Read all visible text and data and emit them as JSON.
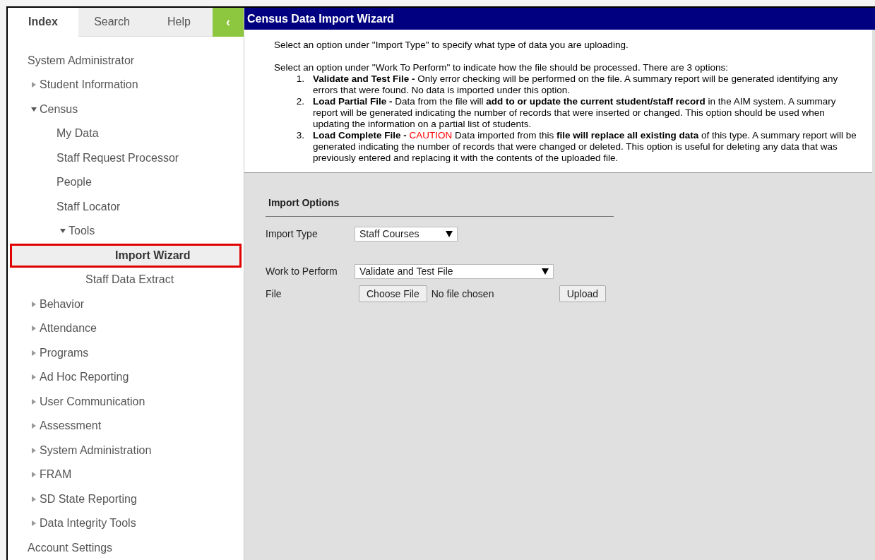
{
  "tabs": [
    {
      "label": "Index",
      "selected": true
    },
    {
      "label": "Search",
      "selected": false
    },
    {
      "label": "Help",
      "selected": false
    }
  ],
  "collapse_button": {
    "label": "‹"
  },
  "tree": [
    {
      "label": "System Administrator",
      "selected": false
    },
    {
      "label": "Student Information",
      "expanded": false,
      "selected": false
    },
    {
      "label": "Census",
      "expanded": true,
      "selected": false,
      "children": [
        {
          "label": "My Data",
          "selected": false
        },
        {
          "label": "Staff Request Processor",
          "selected": false
        },
        {
          "label": "People",
          "selected": false
        },
        {
          "label": "Staff Locator",
          "selected": false
        },
        {
          "label": "Tools",
          "expanded": true,
          "selected": false,
          "children": [
            {
              "label": "Import Wizard",
              "selected": true
            },
            {
              "label": "Staff Data Extract",
              "selected": false
            }
          ]
        }
      ]
    },
    {
      "label": "Behavior",
      "expanded": false,
      "selected": false
    },
    {
      "label": "Attendance",
      "expanded": false,
      "selected": false
    },
    {
      "label": "Programs",
      "expanded": false,
      "selected": false
    },
    {
      "label": "Ad Hoc Reporting",
      "expanded": false,
      "selected": false
    },
    {
      "label": "User Communication",
      "expanded": false,
      "selected": false
    },
    {
      "label": "Assessment",
      "expanded": false,
      "selected": false
    },
    {
      "label": "System Administration",
      "expanded": false,
      "selected": false
    },
    {
      "label": "FRAM",
      "expanded": false,
      "selected": false
    },
    {
      "label": "SD State Reporting",
      "expanded": false,
      "selected": false
    },
    {
      "label": "Data Integrity Tools",
      "expanded": false,
      "selected": false
    },
    {
      "label": "Account Settings",
      "selected": false
    }
  ],
  "page": {
    "title": "Census Data Import Wizard",
    "intro": "Select an option under \"Import Type\" to specify what type of data you are uploading.",
    "lead": "Select an option under \"Work To Perform\" to indicate how the file should be processed. There are 3 options:",
    "options": [
      {
        "number": "1.",
        "text": "**Validate and Test File -** Only error checking will be performed on the file. A summary report will be generated identifying any errors that were found. No data is imported under this option."
      },
      {
        "number": "2.",
        "text": "**Load Partial File -** Data from the file will **add to or update the current student/staff record** in the AIM system. A summary report will be generated indicating the number of records that were inserted or changed. This option should be used when updating the information on a partial list of students."
      },
      {
        "number": "3.",
        "text": "**Load Complete File -**",
        "caution": "CAUTION",
        "rest": "Data imported from this **file will replace all existing data** of this type. A summary report will be generated indicating the number of records that were changed or deleted. This option is useful for deleting any data that was previously entered and replacing it with the contents of the uploaded file."
      }
    ]
  },
  "import_options": {
    "title": "Import Options",
    "import_type": {
      "label": "Import Type",
      "value": "Staff Courses"
    },
    "work_to_perform": {
      "label": "Work to Perform",
      "value": "Validate and Test File"
    },
    "file": {
      "label": "File",
      "button": "Choose File",
      "status": "No file chosen",
      "upload": "Upload"
    }
  }
}
